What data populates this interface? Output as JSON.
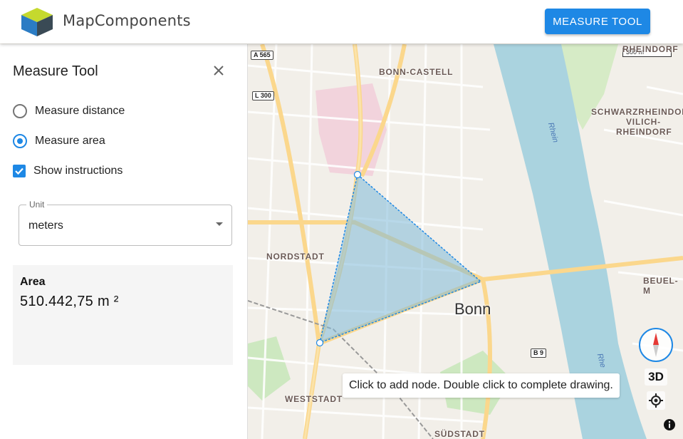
{
  "header": {
    "brand": "MapComponents",
    "measure_button_label": "MEASURE TOOL",
    "logo_icon": "mapcomponents-logo-icon"
  },
  "panel": {
    "title": "Measure Tool",
    "close_icon": "close-icon",
    "options": [
      {
        "label": "Measure distance",
        "selected": false
      },
      {
        "label": "Measure area",
        "selected": true
      }
    ],
    "show_instructions": {
      "label": "Show instructions",
      "checked": true
    },
    "unit": {
      "legend": "Unit",
      "value": "meters"
    },
    "result": {
      "label": "Area",
      "value": "510.442,75 m ²"
    }
  },
  "map": {
    "places": {
      "bonn_castell": "BONN-CASTELL",
      "schwarzrheindorf": "SCHWARZRHEINDORF",
      "vilich": "VILICH-",
      "rheindorf": "RHEINDORF",
      "nordstadt": "NORDSTADT",
      "beuel": "BEUEL-M",
      "weststadt": "WESTSTADT",
      "suedstadt": "SÜDSTADT",
      "rheindorf_top": "RHEINDORF"
    },
    "city": "Bonn",
    "river_label": "Rhein",
    "river_label_2": "Rhe",
    "road_shields": {
      "a565": "A 565",
      "l300": "L 300",
      "b9": "B 9"
    },
    "scale_label": "300 m",
    "tooltip": "Click to add node. Double click to complete drawing.",
    "btn_3d": "3D",
    "compass_icon": "compass-icon",
    "geolocate_icon": "geolocate-icon",
    "info_icon": "info-icon",
    "colors": {
      "polygon_fill": "#7fb9d9",
      "polygon_stroke": "#1e88e5",
      "river": "#aad3df"
    }
  }
}
